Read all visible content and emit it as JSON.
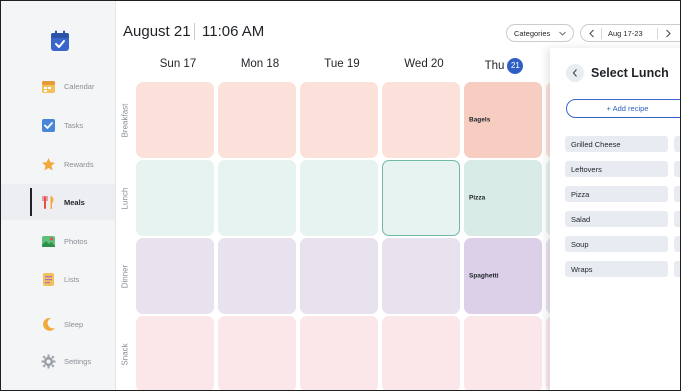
{
  "header": {
    "date": "August 21",
    "time": "11:06 AM",
    "categories_label": "Categories",
    "week_range": "Aug 17-23"
  },
  "sidebar": {
    "items": [
      {
        "label": "Calendar",
        "icon": "calendar-icon"
      },
      {
        "label": "Tasks",
        "icon": "checkbox-icon"
      },
      {
        "label": "Rewards",
        "icon": "star-icon"
      },
      {
        "label": "Meals",
        "icon": "utensils-icon",
        "active": true
      },
      {
        "label": "Photos",
        "icon": "photo-icon"
      },
      {
        "label": "Lists",
        "icon": "list-icon"
      },
      {
        "label": "Sleep",
        "icon": "moon-icon"
      },
      {
        "label": "Settings",
        "icon": "gear-icon"
      }
    ]
  },
  "days": [
    {
      "label": "Sun 17"
    },
    {
      "label": "Mon 18"
    },
    {
      "label": "Tue 19"
    },
    {
      "label": "Wed 20"
    },
    {
      "label": "Thu",
      "badge": "21"
    }
  ],
  "rows": [
    {
      "label": "Breakfast",
      "color": "#fbe1da",
      "filled": "#f6cdc0",
      "entries": [
        "",
        "",
        "",
        "",
        "Bagels"
      ]
    },
    {
      "label": "Lunch",
      "color": "#e6f3f0",
      "filled": "#d8ebe6",
      "entries": [
        "",
        "",
        "",
        "",
        "Pizza"
      ]
    },
    {
      "label": "Dinner",
      "color": "#e8e1ee",
      "filled": "#dcd0e8",
      "entries": [
        "",
        "",
        "",
        "",
        "Spaghetti"
      ]
    },
    {
      "label": "Snack",
      "color": "#fbe7ea",
      "filled": "#f8dfe3",
      "entries": [
        "",
        "",
        "",
        "",
        ""
      ]
    }
  ],
  "panel": {
    "title": "Select Lunch",
    "add_label": "+ Add recipe",
    "recipes": [
      "Grilled Cheese",
      "Leftovers",
      "Pizza",
      "Salad",
      "Soup",
      "Wraps"
    ]
  },
  "colors": {
    "accent": "#2f5fc4",
    "selected_border": "#6fb9a6"
  }
}
